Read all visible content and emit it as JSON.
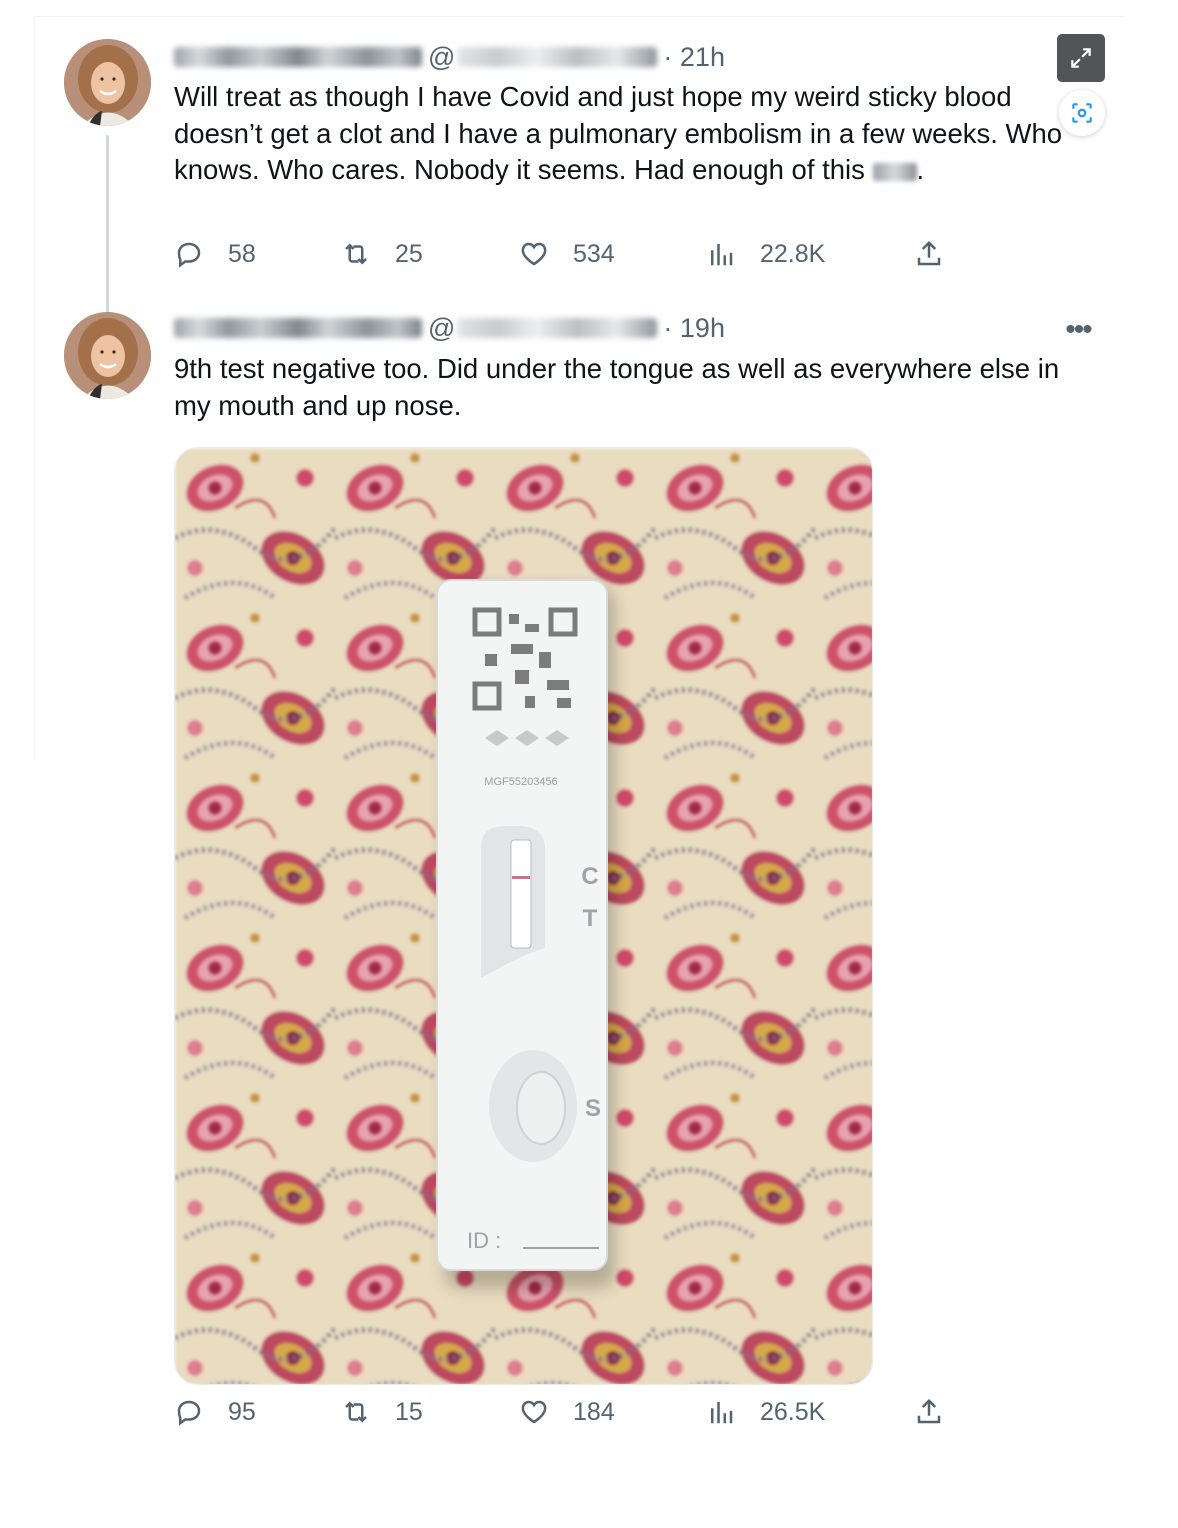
{
  "tweets": [
    {
      "at": "@",
      "time": "· 21h",
      "text_before": "Will treat as though I have Covid and just hope my weird sticky blood doesn’t get a clot and I have a pulmonary embolism in a few weeks. Who knows. Who cares. Nobody it seems. Had enough of this ",
      "text_after": ".",
      "replies": "58",
      "reposts": "25",
      "likes": "534",
      "views": "22.8K"
    },
    {
      "at": "@",
      "time": "· 19h",
      "text": "9th test negative too. Did under the tongue as well as everywhere else in my mouth and up nose.",
      "replies": "95",
      "reposts": "15",
      "likes": "184",
      "views": "26.5K",
      "media": {
        "test_labels": {
          "c": "C",
          "t": "T",
          "s": "S",
          "id": "ID :"
        },
        "serial": "MGF55203456"
      }
    }
  ],
  "icons": {
    "reply": "reply-icon",
    "repost": "repost-icon",
    "like": "like-icon",
    "views": "views-icon",
    "share": "share-icon",
    "expand": "expand-icon",
    "scan": "scan-icon",
    "more": "more-icon"
  },
  "more_glyph": "•••",
  "colors": {
    "text": "#0f1419",
    "muted": "#536471",
    "thread_line": "#cfd9de",
    "accent": "#1d9bf0",
    "expand_bg": "#525558"
  }
}
